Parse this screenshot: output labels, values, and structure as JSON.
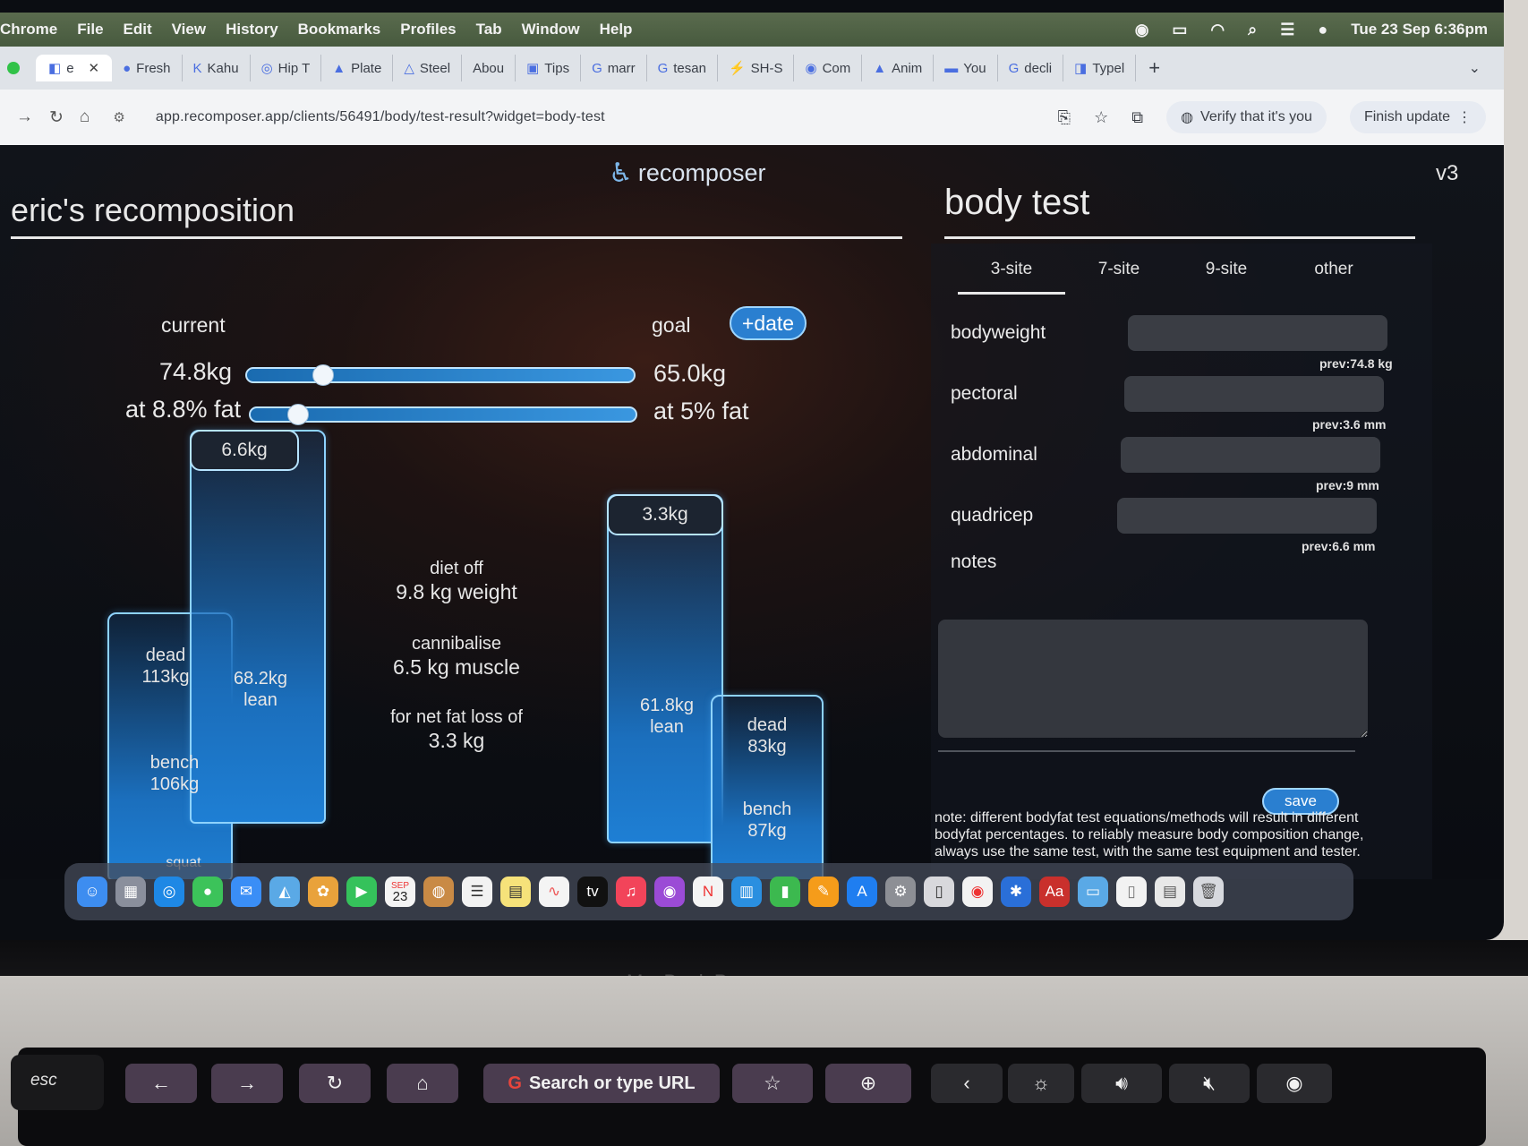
{
  "menubar": {
    "items": [
      "Chrome",
      "File",
      "Edit",
      "View",
      "History",
      "Bookmarks",
      "Profiles",
      "Tab",
      "Window",
      "Help"
    ],
    "datetime": "Tue 23 Sep 6:36pm"
  },
  "tabs": [
    {
      "label": "e",
      "icon": "recomposer-icon",
      "active": true
    },
    {
      "label": "Fresh",
      "icon": "dot-icon"
    },
    {
      "label": "Kahu",
      "icon": "kahu-icon"
    },
    {
      "label": "Hip T",
      "icon": "hip-icon"
    },
    {
      "label": "Plate",
      "icon": "plate-icon"
    },
    {
      "label": "Steel",
      "icon": "steel-icon"
    },
    {
      "label": "Abou",
      "icon": ""
    },
    {
      "label": "Tips",
      "icon": "tips-icon"
    },
    {
      "label": "marr",
      "icon": "google-icon"
    },
    {
      "label": "tesan",
      "icon": "google-icon"
    },
    {
      "label": "SH-S",
      "icon": "bolt-icon"
    },
    {
      "label": "Com",
      "icon": "com-icon"
    },
    {
      "label": "Anim",
      "icon": "anim-icon"
    },
    {
      "label": "You",
      "icon": "you-icon"
    },
    {
      "label": "decli",
      "icon": "google-icon"
    },
    {
      "label": "Typel",
      "icon": "type-icon"
    }
  ],
  "address": {
    "url": "app.recomposer.app/clients/56491/body/test-result?widget=body-test",
    "verify_label": "Verify that it's you",
    "finish_update_label": "Finish update"
  },
  "app": {
    "brand": "recomposer",
    "version": "v3",
    "left_title": "eric's recomposition",
    "current_label": "current",
    "goal_label": "goal",
    "date_button": "+date",
    "current_weight": "74.8kg",
    "current_fat": "at 8.8% fat",
    "goal_weight": "65.0kg",
    "goal_fat": "at 5% fat",
    "weight_slider_fraction": 0.18,
    "fat_slider_fraction": 0.1,
    "current_fat_mass": "6.6kg",
    "current_lean": [
      "68.2kg",
      "lean"
    ],
    "current_lifts": {
      "dead": [
        "dead",
        "113kg"
      ],
      "bench": [
        "bench",
        "106kg"
      ],
      "squat": "squat"
    },
    "middle": {
      "diet_off": "diet off",
      "diet_off_value": "9.8 kg weight",
      "cannibalise": "cannibalise",
      "cannibalise_value": "6.5 kg muscle",
      "net_loss": "for net fat loss of",
      "net_loss_value": "3.3 kg"
    },
    "goal_fat_mass": "3.3kg",
    "goal_lean": [
      "61.8kg",
      "lean"
    ],
    "goal_lifts": {
      "dead": [
        "dead",
        "83kg"
      ],
      "bench": [
        "bench",
        "87kg"
      ]
    }
  },
  "body_test": {
    "title": "body test",
    "tabs": [
      "3-site",
      "7-site",
      "9-site",
      "other"
    ],
    "active_tab": "3-site",
    "fields": [
      {
        "label": "bodyweight",
        "value": "",
        "prev": "prev:74.8 kg"
      },
      {
        "label": "pectoral",
        "value": "",
        "prev": "prev:3.6 mm"
      },
      {
        "label": "abdominal",
        "value": "",
        "prev": "prev:9 mm"
      },
      {
        "label": "quadricep",
        "value": "",
        "prev": "prev:6.6 mm"
      }
    ],
    "notes_label": "notes",
    "notes_value": "",
    "save_label": "save",
    "note_text": "note: different bodyfat test equations/methods will result in different bodyfat percentages. to reliably measure body composition change, always use the same test, with the same test equipment and tester."
  },
  "dock": {
    "calendar_month": "SEP",
    "calendar_day": "23",
    "tv_label": "tv",
    "dictionary_label": "Aa"
  },
  "laptop": {
    "model_label": "MacBook Pro",
    "esc_label": "esc",
    "touchbar_search": "Search or type URL"
  }
}
